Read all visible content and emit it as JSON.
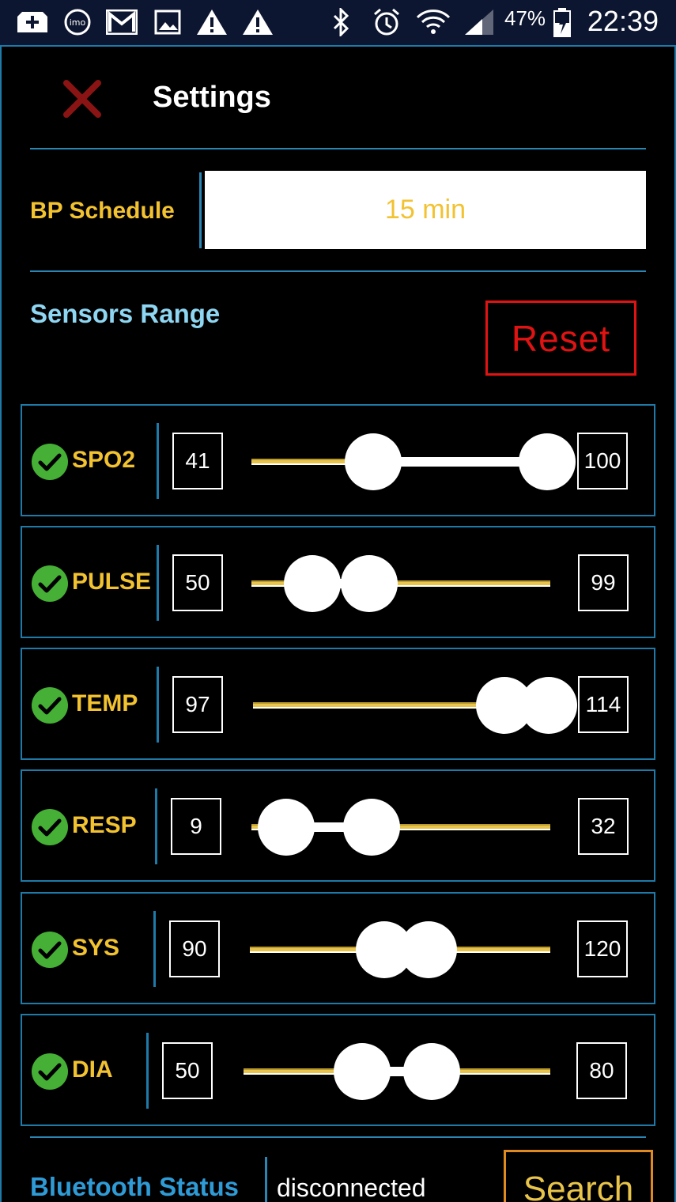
{
  "status_bar": {
    "icons": [
      "add-box-icon",
      "imo-icon",
      "gmail-icon",
      "image-icon",
      "warning-icon",
      "warning-icon",
      "bluetooth-icon",
      "alarm-icon",
      "wifi-icon",
      "signal-icon",
      "battery-icon"
    ],
    "battery": "47%",
    "time": "22:39"
  },
  "header": {
    "title": "Settings"
  },
  "bp_schedule": {
    "label": "BP Schedule",
    "value": "15 min"
  },
  "sensors": {
    "title": "Sensors Range",
    "reset_label": "Reset",
    "rows": [
      {
        "name": "SPO2",
        "min": "41",
        "max": "100"
      },
      {
        "name": "PULSE",
        "min": "50",
        "max": "99"
      },
      {
        "name": "TEMP",
        "min": "97",
        "max": "114"
      },
      {
        "name": "RESP",
        "min": "9",
        "max": "32"
      },
      {
        "name": "SYS",
        "min": "90",
        "max": "120"
      },
      {
        "name": "DIA",
        "min": "50",
        "max": "80"
      }
    ]
  },
  "bluetooth": {
    "label": "Bluetooth Status",
    "status": "disconnected",
    "search_label": "Search"
  },
  "colors": {
    "accent_yellow": "#f2c230",
    "frame_blue": "#1e7aa8",
    "reset_red": "#e01313",
    "check_green": "#45b035"
  }
}
